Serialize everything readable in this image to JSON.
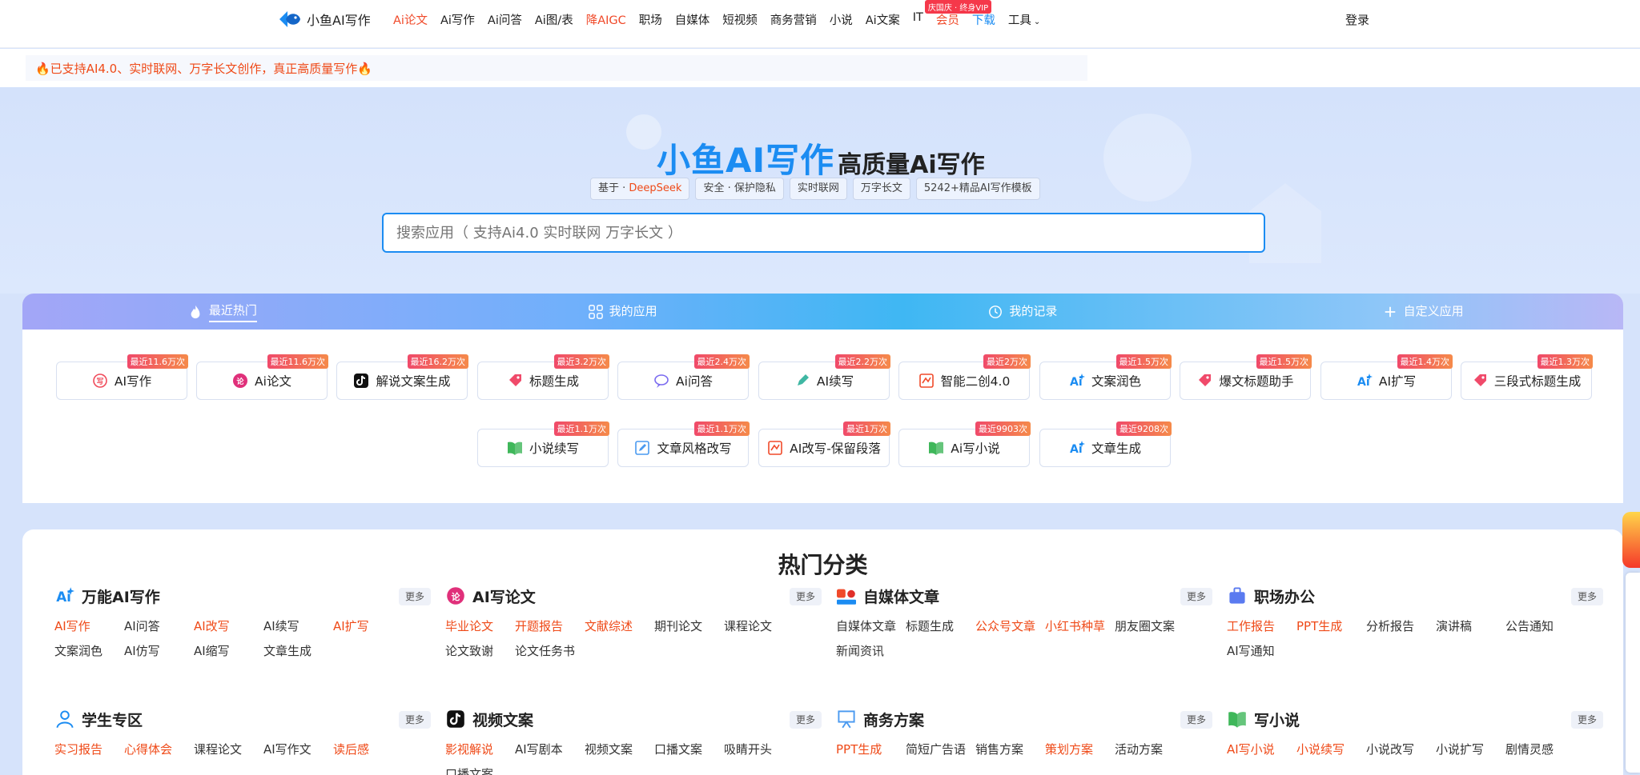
{
  "nav": {
    "logo_text": "小鱼AI写作",
    "items": [
      {
        "label": "Ai论文",
        "style": "red"
      },
      {
        "label": "Ai写作",
        "style": ""
      },
      {
        "label": "Ai问答",
        "style": ""
      },
      {
        "label": "Ai图/表",
        "style": ""
      },
      {
        "label": "降AIGC",
        "style": "red"
      },
      {
        "label": "职场",
        "style": ""
      },
      {
        "label": "自媒体",
        "style": ""
      },
      {
        "label": "短视频",
        "style": ""
      },
      {
        "label": "商务营销",
        "style": ""
      },
      {
        "label": "小说",
        "style": ""
      },
      {
        "label": "Ai文案",
        "style": ""
      },
      {
        "label": "IT",
        "style": ""
      },
      {
        "label": "会员",
        "style": "red"
      },
      {
        "label": "下载",
        "style": "blue"
      },
      {
        "label": "工具",
        "style": ""
      }
    ],
    "vip_badge": "庆国庆 · 终身VIP",
    "login": "登录"
  },
  "notice": {
    "text": "🔥已支持AI4.0、实时联网、万字长文创作，真正高质量写作🔥"
  },
  "hero": {
    "title_main": "小鱼AI写作",
    "title_sub": "高质量Ai写作",
    "tag_based_prefix": "基于 · ",
    "tag_based_highlight": "DeepSeek",
    "tags": [
      "安全 · 保护隐私",
      "实时联网",
      "万字长文",
      "5242+精品AI写作模板"
    ],
    "search_placeholder": "搜索应用（ 支持Ai4.0 实时联网 万字长文 ）"
  },
  "tabs": [
    {
      "label": "最近热门",
      "icon": "flame-icon",
      "active": true
    },
    {
      "label": "我的应用",
      "icon": "grid-icon",
      "active": false
    },
    {
      "label": "我的记录",
      "icon": "clock-icon",
      "active": false
    },
    {
      "label": "自定义应用",
      "icon": "plus-icon",
      "active": false
    }
  ],
  "apps": [
    {
      "label": "AI写作",
      "badge": "最近11.6万次",
      "icon": "write-icon",
      "color": "#f04a5a"
    },
    {
      "label": "Ai论文",
      "badge": "最近11.6万次",
      "icon": "paper-icon",
      "color": "#e0307a"
    },
    {
      "label": "解说文案生成",
      "badge": "最近16.2万次",
      "icon": "tiktok-icon",
      "color": "#111111"
    },
    {
      "label": "标题生成",
      "badge": "最近3.2万次",
      "icon": "tag-icon",
      "color": "#f04a6a"
    },
    {
      "label": "Ai问答",
      "badge": "最近2.4万次",
      "icon": "chat-icon",
      "color": "#7a6af0"
    },
    {
      "label": "AI续写",
      "badge": "最近2.2万次",
      "icon": "pen-icon",
      "color": "#3fb7a3"
    },
    {
      "label": "智能二创4.0",
      "badge": "最近2万次",
      "icon": "rewrite-icon",
      "color": "#f04a2a"
    },
    {
      "label": "文案润色",
      "badge": "最近1.5万次",
      "icon": "ai-spark-icon",
      "color": "#1b8cf2"
    },
    {
      "label": "爆文标题助手",
      "badge": "最近1.5万次",
      "icon": "tag-icon",
      "color": "#f04a6a"
    },
    {
      "label": "AI扩写",
      "badge": "最近1.4万次",
      "icon": "ai-spark-icon",
      "color": "#1b8cf2"
    },
    {
      "label": "三段式标题生成",
      "badge": "最近1.3万次",
      "icon": "tag-icon",
      "color": "#f04a6a"
    },
    {
      "label": "小说续写",
      "badge": "最近1.1万次",
      "icon": "book-icon",
      "color": "#3fb75a"
    },
    {
      "label": "文章风格改写",
      "badge": "最近1.1万次",
      "icon": "edit-icon",
      "color": "#4a9af0"
    },
    {
      "label": "AI改写-保留段落",
      "badge": "最近1万次",
      "icon": "rewrite-icon",
      "color": "#f04a2a"
    },
    {
      "label": "Ai写小说",
      "badge": "最近9903次",
      "icon": "book-icon",
      "color": "#3fb75a"
    },
    {
      "label": "文章生成",
      "badge": "最近9208次",
      "icon": "ai-spark-icon",
      "color": "#1b8cf2"
    }
  ],
  "categories_title": "热门分类",
  "more_label": "更多",
  "categories": [
    {
      "title": "万能AI写作",
      "icon": "ai-spark-icon",
      "color": "#1b8cf2",
      "items": [
        {
          "t": "AI写作",
          "hot": true
        },
        {
          "t": "AI问答",
          "hot": false
        },
        {
          "t": "AI改写",
          "hot": true
        },
        {
          "t": "AI续写",
          "hot": false
        },
        {
          "t": "AI扩写",
          "hot": true
        },
        {
          "t": "文案润色",
          "hot": false
        },
        {
          "t": "AI仿写",
          "hot": false
        },
        {
          "t": "AI缩写",
          "hot": false
        },
        {
          "t": "文章生成",
          "hot": false
        }
      ]
    },
    {
      "title": "AI写论文",
      "icon": "paper-icon",
      "color": "#e0307a",
      "items": [
        {
          "t": "毕业论文",
          "hot": true
        },
        {
          "t": "开题报告",
          "hot": true
        },
        {
          "t": "文献综述",
          "hot": true
        },
        {
          "t": "期刊论文",
          "hot": false
        },
        {
          "t": "课程论文",
          "hot": false
        },
        {
          "t": "论文致谢",
          "hot": false
        },
        {
          "t": "论文任务书",
          "hot": false
        }
      ]
    },
    {
      "title": "自媒体文章",
      "icon": "media-icon",
      "color": "#f04a2a",
      "items": [
        {
          "t": "自媒体文章",
          "hot": false
        },
        {
          "t": "标题生成",
          "hot": false
        },
        {
          "t": "公众号文章",
          "hot": true
        },
        {
          "t": "小红书种草",
          "hot": true
        },
        {
          "t": "朋友圈文案",
          "hot": false
        },
        {
          "t": "新闻资讯",
          "hot": false
        }
      ]
    },
    {
      "title": "职场办公",
      "icon": "briefcase-icon",
      "color": "#5a7af0",
      "items": [
        {
          "t": "工作报告",
          "hot": true
        },
        {
          "t": "PPT生成",
          "hot": true
        },
        {
          "t": "分析报告",
          "hot": false
        },
        {
          "t": "演讲稿",
          "hot": false
        },
        {
          "t": "公告通知",
          "hot": false
        },
        {
          "t": "AI写通知",
          "hot": false
        }
      ]
    },
    {
      "title": "学生专区",
      "icon": "student-icon",
      "color": "#1b8cf2",
      "items": [
        {
          "t": "实习报告",
          "hot": true
        },
        {
          "t": "心得体会",
          "hot": true
        },
        {
          "t": "课程论文",
          "hot": false
        },
        {
          "t": "AI写作文",
          "hot": false
        },
        {
          "t": "读后感",
          "hot": true
        }
      ]
    },
    {
      "title": "视频文案",
      "icon": "tiktok-icon",
      "color": "#111111",
      "items": [
        {
          "t": "影视解说",
          "hot": true
        },
        {
          "t": "AI写剧本",
          "hot": false
        },
        {
          "t": "视频文案",
          "hot": false
        },
        {
          "t": "口播文案",
          "hot": false
        },
        {
          "t": "吸睛开头",
          "hot": false
        },
        {
          "t": "口播文案",
          "hot": false
        }
      ]
    },
    {
      "title": "商务方案",
      "icon": "presentation-icon",
      "color": "#4a9af0",
      "items": [
        {
          "t": "PPT生成",
          "hot": true
        },
        {
          "t": "简短广告语",
          "hot": false
        },
        {
          "t": "销售方案",
          "hot": false
        },
        {
          "t": "策划方案",
          "hot": true
        },
        {
          "t": "活动方案",
          "hot": false
        }
      ]
    },
    {
      "title": "写小说",
      "icon": "book-icon",
      "color": "#3fb75a",
      "items": [
        {
          "t": "AI写小说",
          "hot": true
        },
        {
          "t": "小说续写",
          "hot": true
        },
        {
          "t": "小说改写",
          "hot": false
        },
        {
          "t": "小说扩写",
          "hot": false
        },
        {
          "t": "剧情灵感",
          "hot": false
        }
      ]
    }
  ]
}
